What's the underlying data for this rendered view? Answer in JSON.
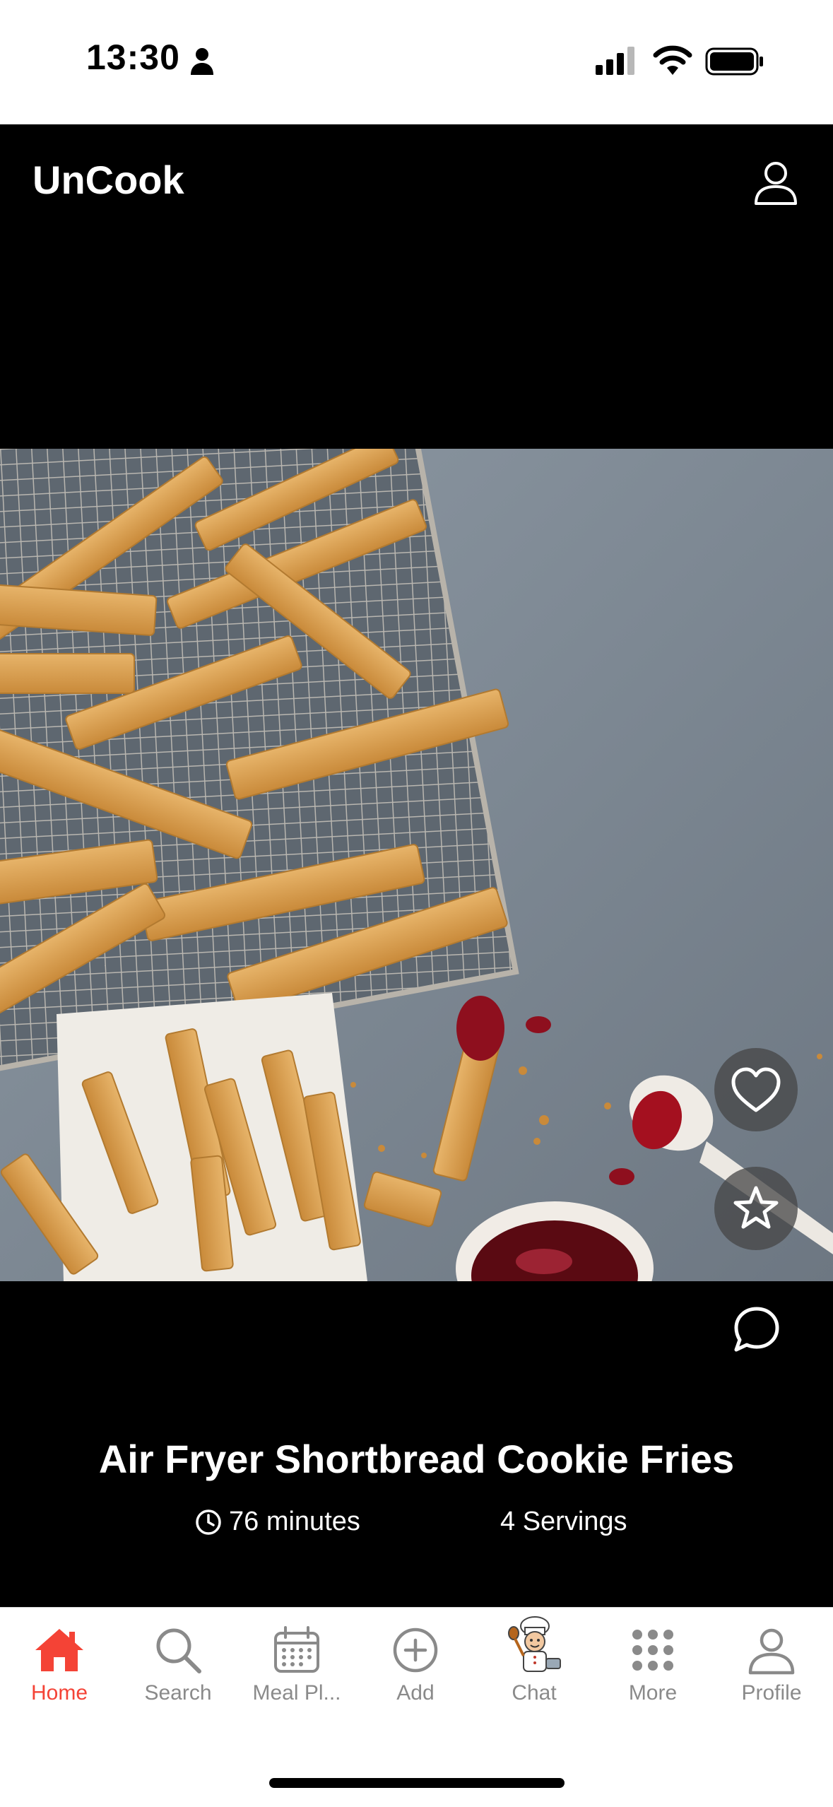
{
  "status_bar": {
    "time": "13:30"
  },
  "header": {
    "app_title": "UnCook"
  },
  "recipe": {
    "title": "Air Fryer Shortbread Cookie Fries",
    "time": "76 minutes",
    "servings": "4 Servings"
  },
  "tabs": [
    {
      "label": "Home",
      "icon": "home-icon",
      "active": true
    },
    {
      "label": "Search",
      "icon": "search-icon"
    },
    {
      "label": "Meal Pl...",
      "icon": "calendar-icon"
    },
    {
      "label": "Add",
      "icon": "add-circle-icon"
    },
    {
      "label": "Chat",
      "icon": "chef-avatar-icon"
    },
    {
      "label": "More",
      "icon": "grid-dots-icon"
    },
    {
      "label": "Profile",
      "icon": "person-icon"
    }
  ],
  "colors": {
    "accent": "#f44336",
    "stage": "#000000",
    "inactive": "#8a8a8a"
  }
}
